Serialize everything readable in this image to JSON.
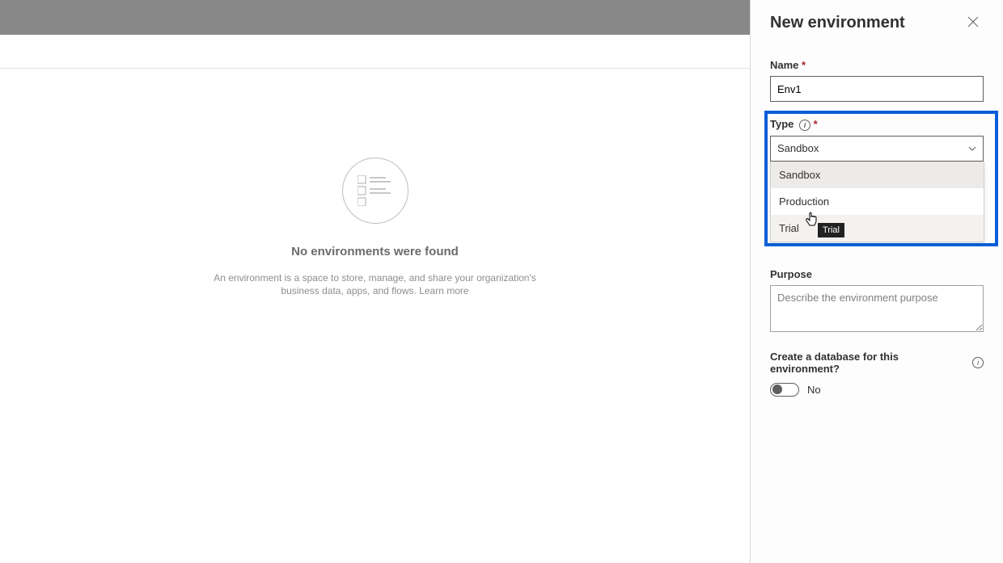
{
  "panel": {
    "title": "New environment",
    "close_aria": "Close"
  },
  "empty": {
    "title": "No environments were found",
    "desc_prefix": "An environment is a space to store, manage, and share your organization's business data, apps, and flows. ",
    "learn_more": "Learn more"
  },
  "fields": {
    "name": {
      "label": "Name",
      "value": "Env1"
    },
    "type": {
      "label": "Type",
      "selected": "Sandbox",
      "options": [
        "Sandbox",
        "Production",
        "Trial"
      ]
    },
    "purpose": {
      "label": "Purpose",
      "placeholder": "Describe the environment purpose"
    },
    "database": {
      "label": "Create a database for this environment?",
      "value": "No"
    }
  },
  "tooltip_trial": "Trial"
}
